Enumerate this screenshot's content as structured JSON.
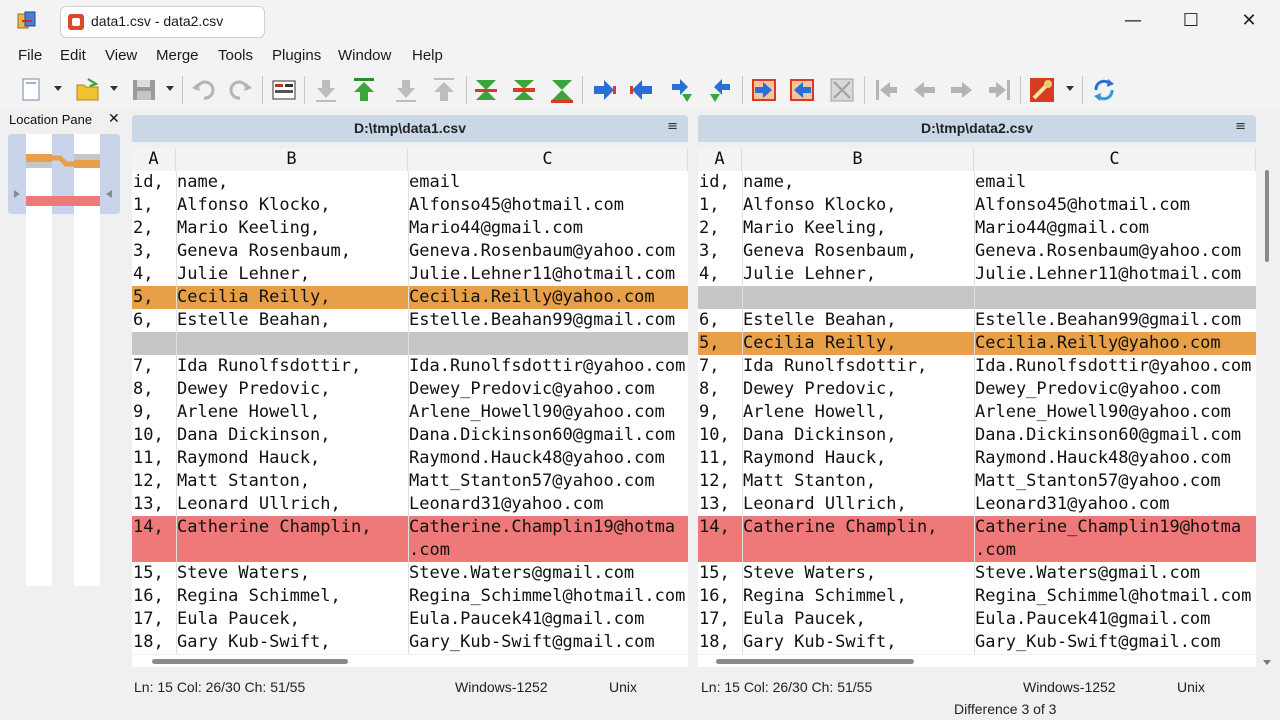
{
  "window": {
    "tab_title": "data1.csv - data2.csv",
    "minimize": "—",
    "maximize": "☐",
    "close": "✕"
  },
  "menu": [
    "File",
    "Edit",
    "View",
    "Merge",
    "Tools",
    "Plugins",
    "Window",
    "Help"
  ],
  "toolbar": {
    "icons": [
      "new-icon",
      "open-icon",
      "save-icon",
      "undo-icon",
      "redo-icon",
      "compare-options-icon",
      "next-diff-icon",
      "first-diff-icon",
      "next-conflict-icon",
      "prev-conflict-icon",
      "merge-down-icon",
      "merge-middle-icon",
      "merge-up-icon",
      "copy-right-icon",
      "copy-left-icon",
      "copy-right-advance-icon",
      "copy-left-advance-icon",
      "copy-all-right-icon",
      "copy-all-left-icon",
      "split-icon",
      "first-file-icon",
      "prev-file-icon",
      "next-file-icon",
      "last-file-icon",
      "tools-icon",
      "refresh-icon"
    ]
  },
  "location_pane": {
    "title": "Location Pane",
    "close": "✕"
  },
  "left": {
    "path": "D:\\tmp\\data1.csv",
    "menu_glyph": "≡",
    "columns": [
      "A",
      "B",
      "C"
    ],
    "rows": [
      {
        "state": "",
        "a": "id,",
        "b": "name,",
        "c": "email"
      },
      {
        "state": "",
        "a": "1,",
        "b": "Alfonso Klocko,",
        "c": "Alfonso45@hotmail.com"
      },
      {
        "state": "",
        "a": "2,",
        "b": "Mario Keeling,",
        "c": "Mario44@gmail.com"
      },
      {
        "state": "",
        "a": "3,",
        "b": "Geneva Rosenbaum,",
        "c": "Geneva.Rosenbaum@yahoo.com"
      },
      {
        "state": "",
        "a": "4,",
        "b": "Julie Lehner,",
        "c": "Julie.Lehner11@hotmail.com"
      },
      {
        "state": "changed",
        "a": "5,",
        "b": "Cecilia Reilly,",
        "c": "Cecilia.Reilly@yahoo.com"
      },
      {
        "state": "",
        "a": "6,",
        "b": "Estelle Beahan,",
        "c": "Estelle.Beahan99@gmail.com"
      },
      {
        "state": "removed",
        "a": "",
        "b": "",
        "c": ""
      },
      {
        "state": "",
        "a": "7,",
        "b": "Ida Runolfsdottir,",
        "c": "Ida.Runolfsdottir@yahoo.com"
      },
      {
        "state": "",
        "a": "8,",
        "b": "Dewey Predovic,",
        "c": "Dewey_Predovic@yahoo.com"
      },
      {
        "state": "",
        "a": "9,",
        "b": "Arlene Howell,",
        "c": "Arlene_Howell90@yahoo.com"
      },
      {
        "state": "",
        "a": "10,",
        "b": "Dana Dickinson,",
        "c": "Dana.Dickinson60@gmail.com"
      },
      {
        "state": "",
        "a": "11,",
        "b": "Raymond Hauck,",
        "c": "Raymond.Hauck48@yahoo.com"
      },
      {
        "state": "",
        "a": "12,",
        "b": "Matt Stanton,",
        "c": "Matt_Stanton57@yahoo.com"
      },
      {
        "state": "",
        "a": "13,",
        "b": "Leonard Ullrich,",
        "c": "Leonard31@yahoo.com"
      },
      {
        "state": "diff2",
        "a": "14,",
        "b": "Catherine Champlin,",
        "c": "Catherine.Champlin19@hotma"
      },
      {
        "state": "diff2",
        "a": "",
        "b": "",
        "c": ".com"
      },
      {
        "state": "",
        "a": "15,",
        "b": "Steve Waters,",
        "c": "Steve.Waters@gmail.com"
      },
      {
        "state": "",
        "a": "16,",
        "b": "Regina Schimmel,",
        "c": "Regina_Schimmel@hotmail.com"
      },
      {
        "state": "",
        "a": "17,",
        "b": "Eula Paucek,",
        "c": "Eula.Paucek41@gmail.com"
      },
      {
        "state": "",
        "a": "18,",
        "b": "Gary Kub-Swift,",
        "c": "Gary_Kub-Swift@gmail.com"
      }
    ],
    "status": {
      "pos": "Ln: 15  Col: 26/30  Ch: 51/55",
      "encoding": "Windows-1252",
      "eol": "Unix"
    }
  },
  "right": {
    "path": "D:\\tmp\\data2.csv",
    "menu_glyph": "≡",
    "columns": [
      "A",
      "B",
      "C"
    ],
    "rows": [
      {
        "state": "",
        "a": "id,",
        "b": "name,",
        "c": "email"
      },
      {
        "state": "",
        "a": "1,",
        "b": "Alfonso Klocko,",
        "c": "Alfonso45@hotmail.com"
      },
      {
        "state": "",
        "a": "2,",
        "b": "Mario Keeling,",
        "c": "Mario44@gmail.com"
      },
      {
        "state": "",
        "a": "3,",
        "b": "Geneva Rosenbaum,",
        "c": "Geneva.Rosenbaum@yahoo.com"
      },
      {
        "state": "",
        "a": "4,",
        "b": "Julie Lehner,",
        "c": "Julie.Lehner11@hotmail.com"
      },
      {
        "state": "removed",
        "a": "",
        "b": "",
        "c": ""
      },
      {
        "state": "",
        "a": "6,",
        "b": "Estelle Beahan,",
        "c": "Estelle.Beahan99@gmail.com"
      },
      {
        "state": "changed",
        "a": "5,",
        "b": "Cecilia Reilly,",
        "c": "Cecilia.Reilly@yahoo.com"
      },
      {
        "state": "",
        "a": "7,",
        "b": "Ida Runolfsdottir,",
        "c": "Ida.Runolfsdottir@yahoo.com"
      },
      {
        "state": "",
        "a": "8,",
        "b": "Dewey Predovic,",
        "c": "Dewey_Predovic@yahoo.com"
      },
      {
        "state": "",
        "a": "9,",
        "b": "Arlene Howell,",
        "c": "Arlene_Howell90@yahoo.com"
      },
      {
        "state": "",
        "a": "10,",
        "b": "Dana Dickinson,",
        "c": "Dana.Dickinson60@gmail.com"
      },
      {
        "state": "",
        "a": "11,",
        "b": "Raymond Hauck,",
        "c": "Raymond.Hauck48@yahoo.com"
      },
      {
        "state": "",
        "a": "12,",
        "b": "Matt Stanton,",
        "c": "Matt_Stanton57@yahoo.com"
      },
      {
        "state": "",
        "a": "13,",
        "b": "Leonard Ullrich,",
        "c": "Leonard31@yahoo.com"
      },
      {
        "state": "diff2",
        "a": "14,",
        "b": "Catherine Champlin,",
        "c": "Catherine_Champlin19@hotma"
      },
      {
        "state": "diff2",
        "a": "",
        "b": "",
        "c": ".com"
      },
      {
        "state": "",
        "a": "15,",
        "b": "Steve Waters,",
        "c": "Steve.Waters@gmail.com"
      },
      {
        "state": "",
        "a": "16,",
        "b": "Regina Schimmel,",
        "c": "Regina_Schimmel@hotmail.com"
      },
      {
        "state": "",
        "a": "17,",
        "b": "Eula Paucek,",
        "c": "Eula.Paucek41@gmail.com"
      },
      {
        "state": "",
        "a": "18,",
        "b": "Gary Kub-Swift,",
        "c": "Gary_Kub-Swift@gmail.com"
      }
    ],
    "status": {
      "pos": "Ln: 15  Col: 26/30  Ch: 51/55",
      "encoding": "Windows-1252",
      "eol": "Unix"
    }
  },
  "difference_status": "Difference 3 of 3",
  "colors": {
    "changed": "#e8a048",
    "removed": "#c6c6c6",
    "diff": "#ef7878",
    "header": "#cad7e6"
  }
}
